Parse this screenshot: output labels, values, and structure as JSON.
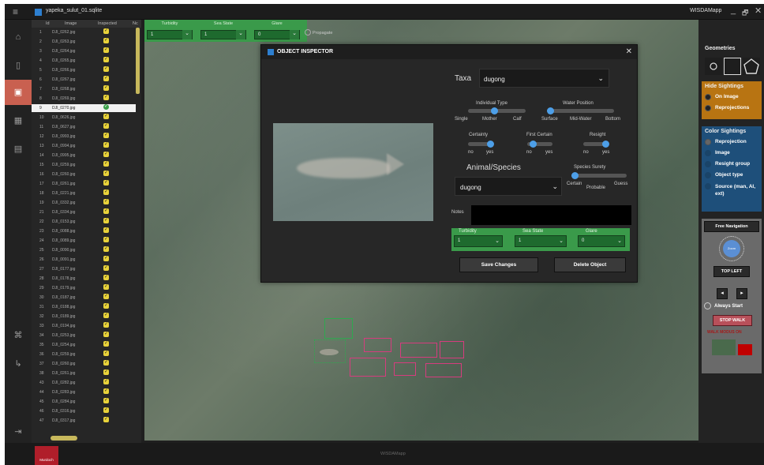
{
  "titlebar": {
    "menu_icon": "hamburger-icon",
    "file_name": "yapeka_sulut_01.sqlite",
    "app_name": "WISDAMapp",
    "minimize": "_",
    "restore": "🗗",
    "close": "✕"
  },
  "rail": {
    "icons": [
      "home-icon",
      "book-icon",
      "image-icon",
      "grid-icon",
      "document-icon",
      "hierarchy-icon",
      "flow-icon",
      "exit-icon"
    ]
  },
  "list": {
    "headers": {
      "id": "Id",
      "image": "Image",
      "inspected": "Inspected",
      "no": "Nc"
    },
    "rows": [
      {
        "id": "1",
        "img": "DJI_0262.jpg"
      },
      {
        "id": "2",
        "img": "DJI_0263.jpg"
      },
      {
        "id": "3",
        "img": "DJI_0264.jpg"
      },
      {
        "id": "4",
        "img": "DJI_0265.jpg"
      },
      {
        "id": "5",
        "img": "DJI_0266.jpg"
      },
      {
        "id": "6",
        "img": "DJI_0267.jpg"
      },
      {
        "id": "7",
        "img": "DJI_0268.jpg"
      },
      {
        "id": "8",
        "img": "DJI_0269.jpg"
      },
      {
        "id": "9",
        "img": "DJI_0270.jpg",
        "selected": true
      },
      {
        "id": "10",
        "img": "DJI_0626.jpg"
      },
      {
        "id": "11",
        "img": "DJI_0627.jpg"
      },
      {
        "id": "12",
        "img": "DJI_0993.jpg"
      },
      {
        "id": "13",
        "img": "DJI_0994.jpg"
      },
      {
        "id": "14",
        "img": "DJI_0995.jpg"
      },
      {
        "id": "15",
        "img": "DJI_0259.jpg"
      },
      {
        "id": "16",
        "img": "DJI_0260.jpg"
      },
      {
        "id": "17",
        "img": "DJI_0261.jpg"
      },
      {
        "id": "18",
        "img": "DJI_0221.jpg"
      },
      {
        "id": "19",
        "img": "DJI_0332.jpg"
      },
      {
        "id": "21",
        "img": "DJI_0334.jpg"
      },
      {
        "id": "22",
        "img": "DJI_0153.jpg"
      },
      {
        "id": "23",
        "img": "DJI_0088.jpg"
      },
      {
        "id": "24",
        "img": "DJI_0089.jpg"
      },
      {
        "id": "25",
        "img": "DJI_0090.jpg"
      },
      {
        "id": "26",
        "img": "DJI_0091.jpg"
      },
      {
        "id": "27",
        "img": "DJI_0177.jpg"
      },
      {
        "id": "28",
        "img": "DJI_0178.jpg"
      },
      {
        "id": "29",
        "img": "DJI_0179.jpg"
      },
      {
        "id": "30",
        "img": "DJI_0187.jpg"
      },
      {
        "id": "31",
        "img": "DJI_0188.jpg"
      },
      {
        "id": "32",
        "img": "DJI_0189.jpg"
      },
      {
        "id": "33",
        "img": "DJI_0194.jpg"
      },
      {
        "id": "34",
        "img": "DJI_0253.jpg"
      },
      {
        "id": "35",
        "img": "DJI_0254.jpg"
      },
      {
        "id": "36",
        "img": "DJI_0259.jpg"
      },
      {
        "id": "37",
        "img": "DJI_0260.jpg"
      },
      {
        "id": "38",
        "img": "DJI_0261.jpg"
      },
      {
        "id": "43",
        "img": "DJI_0282.jpg"
      },
      {
        "id": "44",
        "img": "DJI_0283.jpg"
      },
      {
        "id": "45",
        "img": "DJI_0284.jpg"
      },
      {
        "id": "46",
        "img": "DJI_0316.jpg"
      },
      {
        "id": "47",
        "img": "DJI_0317.jpg"
      }
    ]
  },
  "filters": {
    "turbidity": {
      "label": "Turbidity",
      "value": "1"
    },
    "sea_state": {
      "label": "Sea State",
      "value": "1"
    },
    "glare": {
      "label": "Glare",
      "value": "0"
    },
    "propagate": "Propagate"
  },
  "inspector": {
    "title": "OBJECT INSPECTOR",
    "close": "✕",
    "taxa_label": "Taxa",
    "taxa_value": "dugong",
    "individual_type": {
      "label": "Individual Type",
      "options": [
        "Single",
        "Mother",
        "Calf"
      ],
      "selected": 1
    },
    "water_position": {
      "label": "Water Position",
      "options": [
        "Surface",
        "Mid-Water",
        "Bottom"
      ],
      "selected": 0
    },
    "certainty": {
      "label": "Certainty",
      "options": [
        "no",
        "yes"
      ],
      "selected": 1
    },
    "first_certain": {
      "label": "First Certain",
      "options": [
        "no",
        "yes"
      ],
      "selected": 1
    },
    "resight": {
      "label": "Resight",
      "options": [
        "no",
        "yes"
      ],
      "selected": 1
    },
    "animal_species_label": "Animal/Species",
    "species_value": "dugong",
    "species_surety": {
      "label": "Species Surety",
      "options": [
        "Certain",
        "Probable",
        "Guess"
      ],
      "selected": 0
    },
    "notes_label": "Notes",
    "notes_value": "",
    "turbidity": {
      "label": "Turbidity",
      "value": "1"
    },
    "sea_state": {
      "label": "Sea State",
      "value": "1"
    },
    "glare": {
      "label": "Glare",
      "value": "0"
    },
    "save_btn": "Save Changes",
    "delete_btn": "Delete Object"
  },
  "right": {
    "geometries": "Geometries",
    "hide_sightings": "Hide Sightings",
    "on_image": "On Image",
    "reprojections": "Reprojections",
    "color_sightings": "Color Sightings",
    "color_opts": [
      "Reprojection",
      "Image",
      "Resight group",
      "Object type",
      "Source (man, AI, ext)"
    ],
    "free_navigation": "Free Navigation",
    "knob_label": "Zoom",
    "top_left": "TOP LEFT",
    "always_start": "Always Start",
    "stop_walk": "STOP WALK",
    "walk_mode_on": "WALK MODUS ON",
    "colors": {
      "orange": "#b87412",
      "blue": "#1e4f7a",
      "green": "#3a9a4a",
      "pink": "#d63c7e"
    }
  },
  "footer": {
    "logo_text": "Murdoch",
    "center": "WISDAMapp"
  }
}
